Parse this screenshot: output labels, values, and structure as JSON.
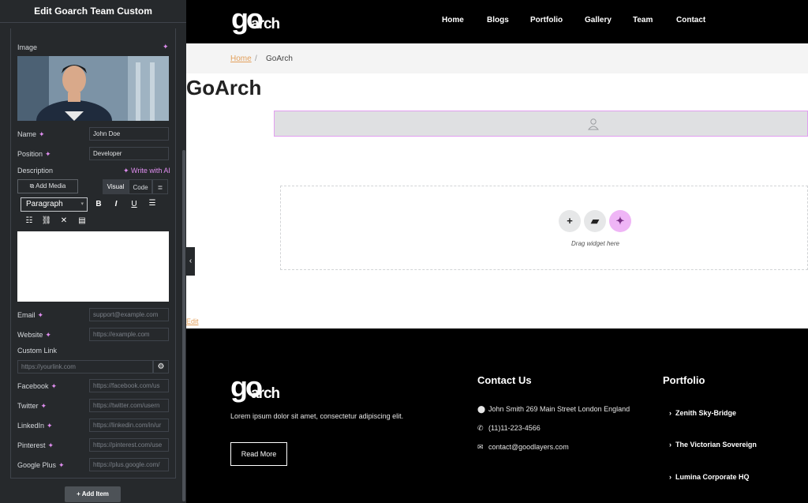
{
  "panel": {
    "title": "Edit Goarch Team Custom",
    "image_label": "Image",
    "name_label": "Name",
    "name_value": "John Doe",
    "position_label": "Position",
    "position_value": "Developer",
    "description_label": "Description",
    "write_ai": "Write with AI",
    "add_media": "Add Media",
    "tab_visual": "Visual",
    "tab_code": "Code",
    "paragraph_select": "Paragraph",
    "email_label": "Email",
    "email_placeholder": "support@example.com",
    "website_label": "Website",
    "website_placeholder": "https://example.com",
    "custom_link_label": "Custom Link",
    "custom_link_placeholder": "https://yourlink.com",
    "facebook_label": "Facebook",
    "facebook_placeholder": "https://facebook.com/us",
    "twitter_label": "Twitter",
    "twitter_placeholder": "https://twitter.com/usern",
    "linkedin_label": "LinkedIn",
    "linkedin_placeholder": "https://linkedin.com/in/ur",
    "pinterest_label": "Pinterest",
    "pinterest_placeholder": "https://pinterest.com/use",
    "googleplus_label": "Google Plus",
    "googleplus_placeholder": "https://plus.google.com/",
    "add_item": "Add Item"
  },
  "header": {
    "logo_go": "go",
    "logo_arch": "arch",
    "nav": [
      "Home",
      "Blogs",
      "Portfolio",
      "Gallery",
      "Team",
      "Contact"
    ]
  },
  "breadcrumb": {
    "home": "Home",
    "sep": "/",
    "current": "GoArch"
  },
  "page": {
    "title": "GoArch",
    "drag_text": "Drag widget here",
    "edit_link": "Edit"
  },
  "footer": {
    "logo_go": "go",
    "logo_arch": "arch",
    "description": "Lorem ipsum dolor sit amet, consectetur adipiscing elit.",
    "read_more": "Read More",
    "contact_heading": "Contact Us",
    "address": "John Smith 269 Main Street London England",
    "phone": "(11)11-223-4566",
    "email": "contact@goodlayers.com",
    "portfolio_heading": "Portfolio",
    "portfolio_items": [
      "Zenith Sky-Bridge",
      "The Victorian Sovereign",
      "Lumina Corporate HQ"
    ]
  },
  "colors": {
    "panel_bg": "#26292c",
    "accent_pink": "#e29ef0",
    "link_orange": "#e3a05b"
  }
}
